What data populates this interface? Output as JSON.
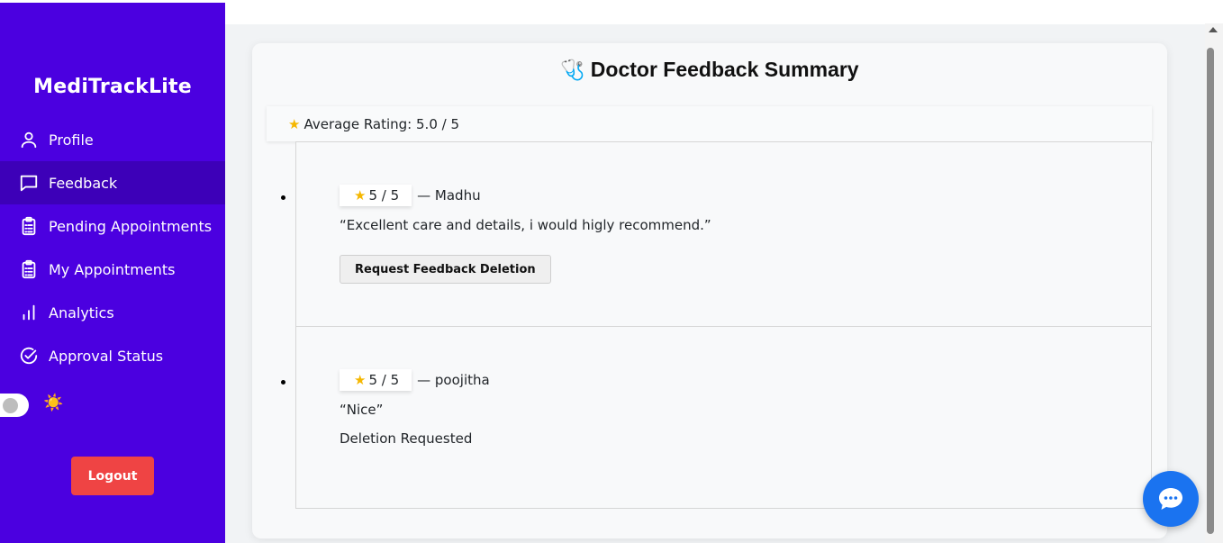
{
  "sidebar": {
    "brand": "MediTrackLite",
    "items": [
      {
        "label": "Profile",
        "icon": "user-icon",
        "active": false
      },
      {
        "label": "Feedback",
        "icon": "message-icon",
        "active": true
      },
      {
        "label": "Pending Appointments",
        "icon": "clipboard-icon",
        "active": false
      },
      {
        "label": "My Appointments",
        "icon": "clipboard-icon",
        "active": false
      },
      {
        "label": "Analytics",
        "icon": "bar-chart-icon",
        "active": false
      },
      {
        "label": "Approval Status",
        "icon": "check-circle-icon",
        "active": false
      }
    ],
    "theme_toggle_icon": "☀️",
    "logout_label": "Logout"
  },
  "main": {
    "title_emoji": "🩺",
    "title": "Doctor Feedback Summary",
    "average_rating": "Average Rating: 5.0 / 5",
    "feedback": [
      {
        "rating": "5 / 5",
        "author": "— Madhu",
        "comment": "“Excellent care and details, i would higly recommend.”",
        "action_label": "Request Feedback Deletion"
      },
      {
        "rating": "5 / 5",
        "author": "— poojitha",
        "comment": "“Nice”",
        "status": "Deletion Requested"
      }
    ]
  },
  "colors": {
    "sidebar_bg": "#4b00e0",
    "sidebar_active": "#3d00b8",
    "logout_bg": "#ef4444",
    "chat_fab": "#1a73f0"
  }
}
